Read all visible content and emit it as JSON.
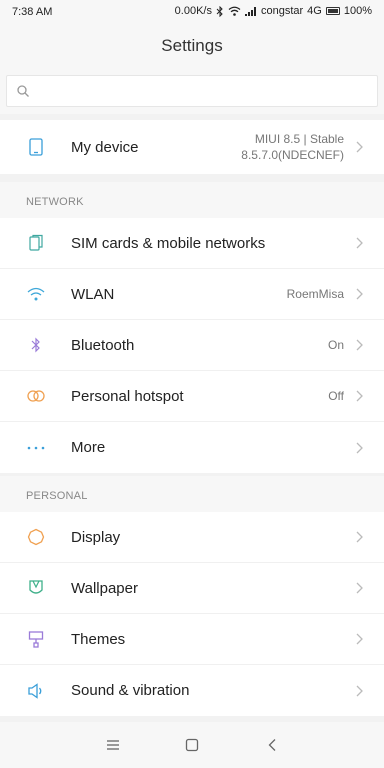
{
  "status_bar": {
    "time": "7:38 AM",
    "speed": "0.00K/s",
    "carrier": "congstar",
    "network_type": "4G",
    "battery": "100%"
  },
  "header": {
    "title": "Settings"
  },
  "search": {
    "placeholder": ""
  },
  "my_device": {
    "label": "My device",
    "value_line1": "MIUI 8.5 | Stable",
    "value_line2": "8.5.7.0(NDECNEF)"
  },
  "network": {
    "section_title": "NETWORK",
    "items": [
      {
        "label": "SIM cards & mobile networks",
        "value": "",
        "icon": "sim-icon"
      },
      {
        "label": "WLAN",
        "value": "RoemMisa",
        "icon": "wifi-icon"
      },
      {
        "label": "Bluetooth",
        "value": "On",
        "icon": "bluetooth-icon"
      },
      {
        "label": "Personal hotspot",
        "value": "Off",
        "icon": "hotspot-icon"
      },
      {
        "label": "More",
        "value": "",
        "icon": "more-icon"
      }
    ]
  },
  "personal": {
    "section_title": "PERSONAL",
    "items": [
      {
        "label": "Display",
        "value": "",
        "icon": "display-icon"
      },
      {
        "label": "Wallpaper",
        "value": "",
        "icon": "wallpaper-icon"
      },
      {
        "label": "Themes",
        "value": "",
        "icon": "themes-icon"
      },
      {
        "label": "Sound & vibration",
        "value": "",
        "icon": "sound-icon"
      }
    ]
  },
  "colors": {
    "icon_teal": "#3fa8a0",
    "icon_blue": "#3a9fd9",
    "icon_purple": "#9a7bd8",
    "icon_orange": "#f0a050",
    "icon_green": "#3fb08a"
  },
  "navbar": {
    "icons": [
      "menu-icon",
      "home-icon",
      "back-icon"
    ]
  }
}
